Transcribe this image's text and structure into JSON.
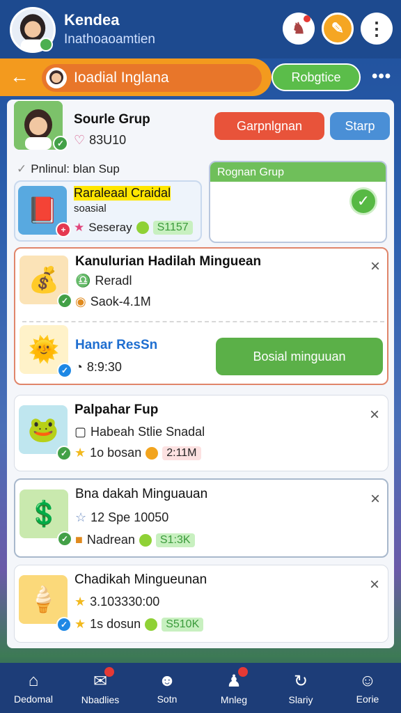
{
  "header": {
    "user_name": "Kendea",
    "user_sub": "Inathoaoamtien",
    "icons": [
      "gift-icon",
      "edit-icon",
      "more-icon"
    ]
  },
  "search": {
    "back_icon": "←",
    "text": "Ioadial Inglana",
    "action_label": "Robgtice",
    "more": "•••"
  },
  "group": {
    "title": "Sourle Grup",
    "meta": "83U10",
    "btn_red": "Garpnlgnan",
    "btn_blue": "Starp",
    "section_label": "Pnlinul: blan Sup",
    "box_label": "Rognan Grup",
    "featured": {
      "title": "Raraleaal Craidal",
      "sub": "soasial",
      "stat_label": "Seseray",
      "stat_value": "S1157"
    }
  },
  "cards": [
    {
      "title": "Kanulurian Hadilah Minguean",
      "line1": "Reradl",
      "line2": "Saok-4.1M",
      "sub_title": "Hanar ResSn",
      "sub_line": "8:9:30",
      "action": "Bosial minguuan",
      "close": "×"
    },
    {
      "title": "Palpahar Fup",
      "line1": "Habeah Stlie Snadal",
      "line2_label": "1o bosan",
      "line2_value": "2:11M",
      "close": "×"
    },
    {
      "title": "Bna dakah Minguauan",
      "line1": "12 Spe 10050",
      "line2_label": "Nadrean",
      "line2_value": "S1:3K",
      "close": "×"
    },
    {
      "title": "Chadikah Mingueunan",
      "line1": "3.103330:00",
      "line2_label": "1s dosun",
      "line2_value": "S510K",
      "close": "×"
    }
  ],
  "nav": [
    {
      "label": "Dedomal",
      "icon": "home-icon"
    },
    {
      "label": "Nbadlies",
      "icon": "chat-icon"
    },
    {
      "label": "Sotn",
      "icon": "mascot-icon"
    },
    {
      "label": "Mnleg",
      "icon": "group-icon"
    },
    {
      "label": "Slariy",
      "icon": "refresh-icon"
    },
    {
      "label": "Eorie",
      "icon": "profile-icon"
    }
  ]
}
